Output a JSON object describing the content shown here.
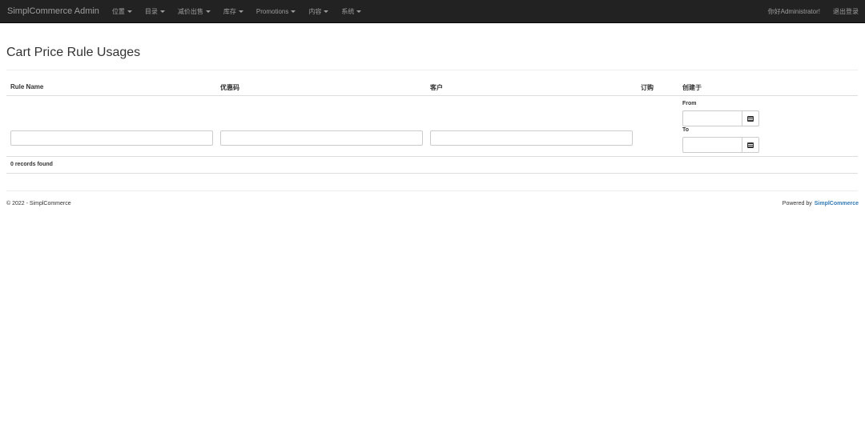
{
  "navbar": {
    "brand": "SimplCommerce Admin",
    "menu": [
      {
        "label": "位置"
      },
      {
        "label": "目录"
      },
      {
        "label": "减价出售"
      },
      {
        "label": "库存"
      },
      {
        "label": "Promotions"
      },
      {
        "label": "内容"
      },
      {
        "label": "系统"
      }
    ],
    "greeting": "你好Administrator!",
    "logout": "退出登录"
  },
  "page": {
    "title": "Cart Price Rule Usages"
  },
  "table": {
    "headers": {
      "rule_name": "Rule Name",
      "coupon_code": "优惠码",
      "customer": "客户",
      "order": "订购",
      "created_on": "创建于"
    },
    "filters": {
      "from_label": "From",
      "to_label": "To"
    },
    "records": "0 records found"
  },
  "footer": {
    "copyright": "© 2022 - SimplCommerce",
    "powered_by": "Powered by",
    "powered_link": "SimplCommerce"
  },
  "colors": {
    "navbar_bg": "#222222",
    "nav_text": "#9d9d9d",
    "link": "#337ab7"
  }
}
